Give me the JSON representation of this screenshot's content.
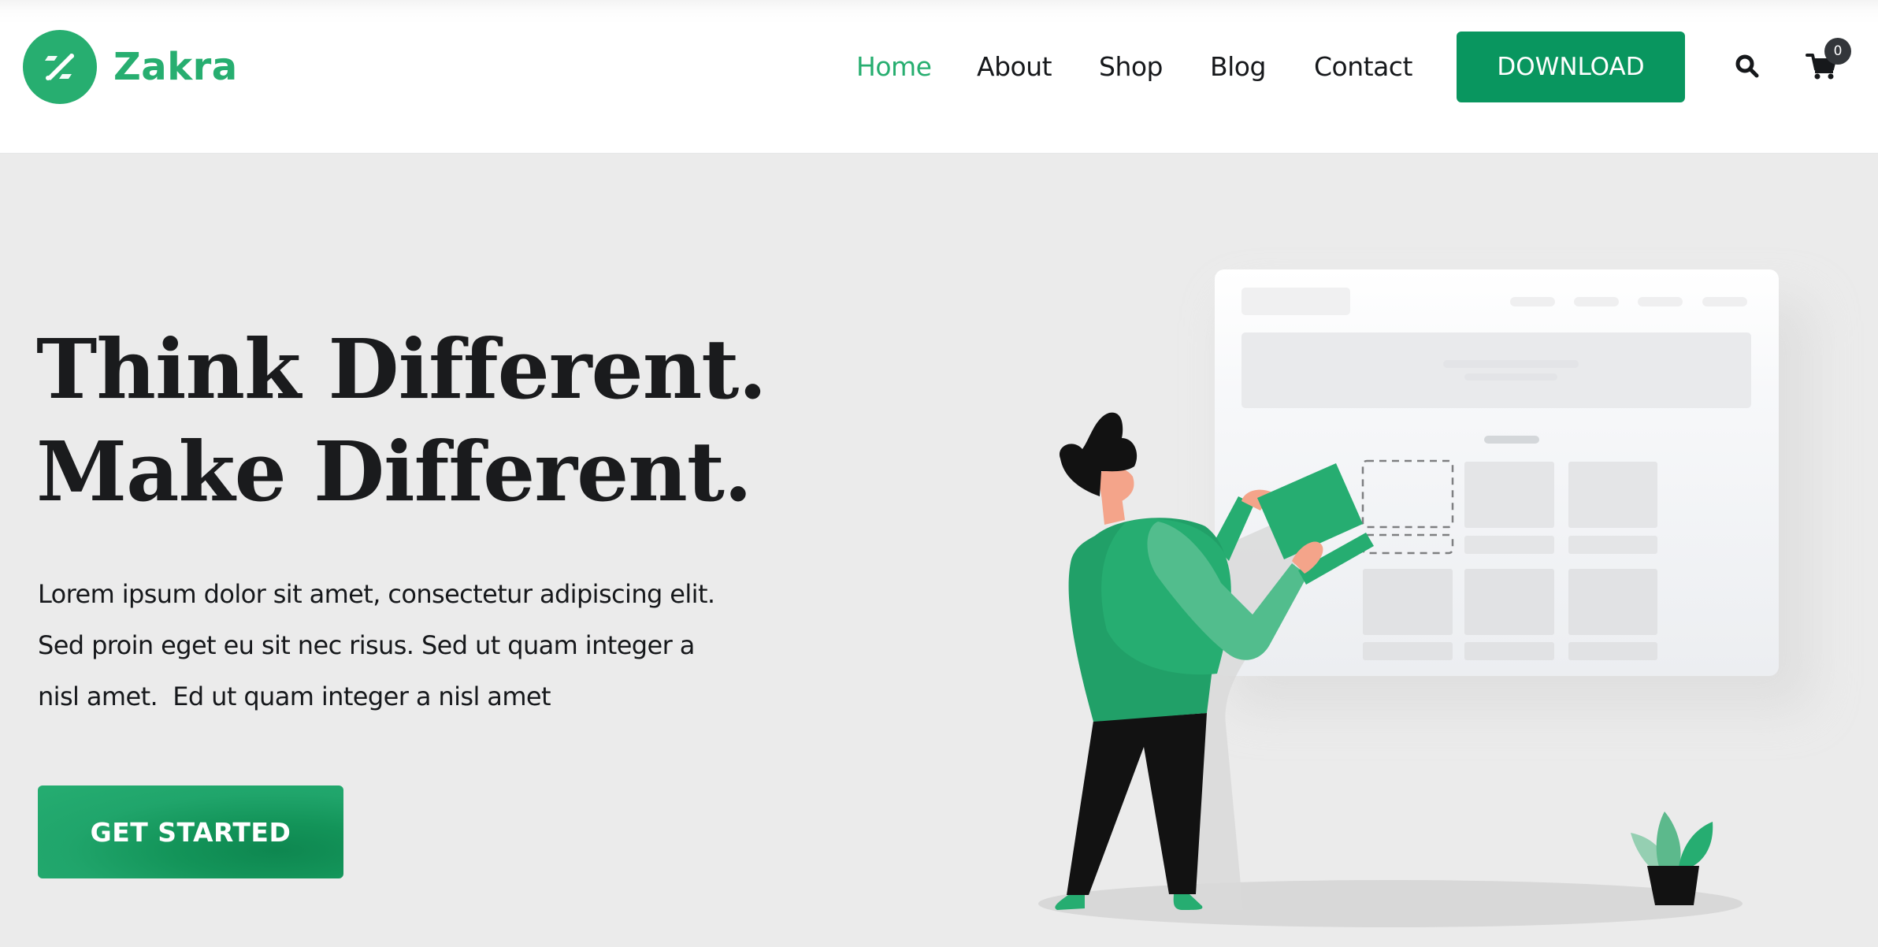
{
  "brand": {
    "name": "Zakra",
    "accent_color": "#27ae70",
    "button_color": "#09965f"
  },
  "nav": {
    "items": [
      {
        "label": "Home",
        "active": true
      },
      {
        "label": "About",
        "active": false
      },
      {
        "label": "Shop",
        "active": false
      },
      {
        "label": "Blog",
        "active": false
      },
      {
        "label": "Contact",
        "active": false
      }
    ],
    "download_label": "DOWNLOAD",
    "search_icon": "search-icon",
    "cart_icon": "cart-icon",
    "cart_count": "0"
  },
  "hero": {
    "title_lines": [
      "Think Different.",
      "Make Different."
    ],
    "text_lines": [
      "Lorem ipsum dolor sit amet, consectetur adipiscing elit.",
      "Sed proin eget eu sit nec risus. Sed ut quam integer a",
      "nisl amet.  Ed ut quam integer a nisl amet"
    ],
    "cta_label": "GET STARTED"
  },
  "illustration": {
    "description": "person placing a green card into a website layout wireframe, with potted plant",
    "colors": {
      "shirt": "#26ad71",
      "shirt_dark": "#21a068",
      "sleeve_light": "#52bd8d",
      "skin": "#f4a48a",
      "hair_pants": "#121212",
      "card_green": "#26ad71"
    }
  }
}
